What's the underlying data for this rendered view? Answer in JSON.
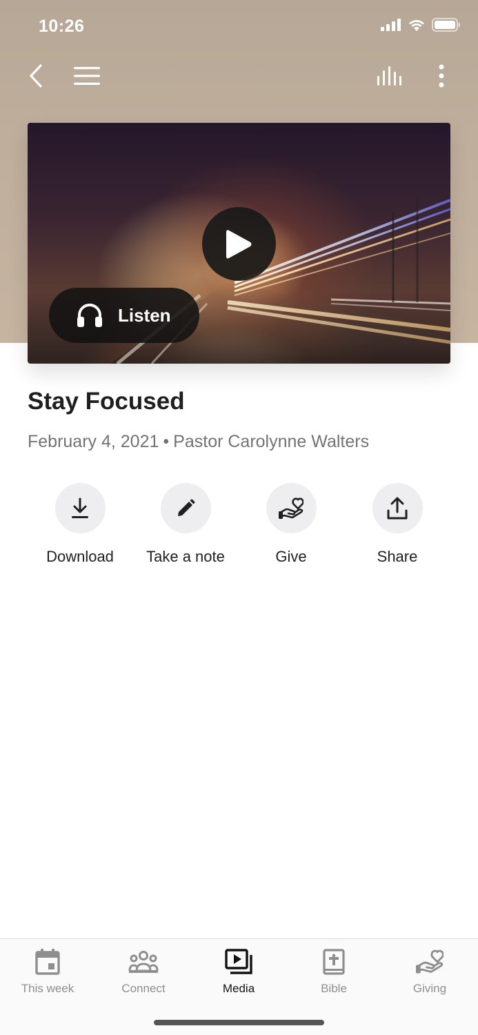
{
  "status_bar": {
    "time": "10:26"
  },
  "top_bar": {
    "icons": [
      "chevron-left-icon",
      "menu-icon",
      "audio-levels-icon",
      "more-vertical-icon"
    ]
  },
  "media": {
    "listen_label": "Listen"
  },
  "sermon": {
    "title": "Stay Focused",
    "date": "February 4, 2021",
    "separator": "•",
    "speaker": "Pastor Carolynne Walters"
  },
  "actions": [
    {
      "label": "Download",
      "icon": "download-icon"
    },
    {
      "label": "Take a note",
      "icon": "pencil-icon"
    },
    {
      "label": "Give",
      "icon": "hand-heart-icon"
    },
    {
      "label": "Share",
      "icon": "share-icon"
    }
  ],
  "tabs": [
    {
      "label": "This week",
      "icon": "calendar-icon",
      "active": false
    },
    {
      "label": "Connect",
      "icon": "people-icon",
      "active": false
    },
    {
      "label": "Media",
      "icon": "media-icon",
      "active": true
    },
    {
      "label": "Bible",
      "icon": "bible-icon",
      "active": false
    },
    {
      "label": "Giving",
      "icon": "hand-heart-icon",
      "active": false
    }
  ],
  "colors": {
    "header_background": "#bfae9c",
    "action_circle": "#eeeef0",
    "active_tab": "#111111",
    "inactive_tab": "#8e8e8e"
  }
}
